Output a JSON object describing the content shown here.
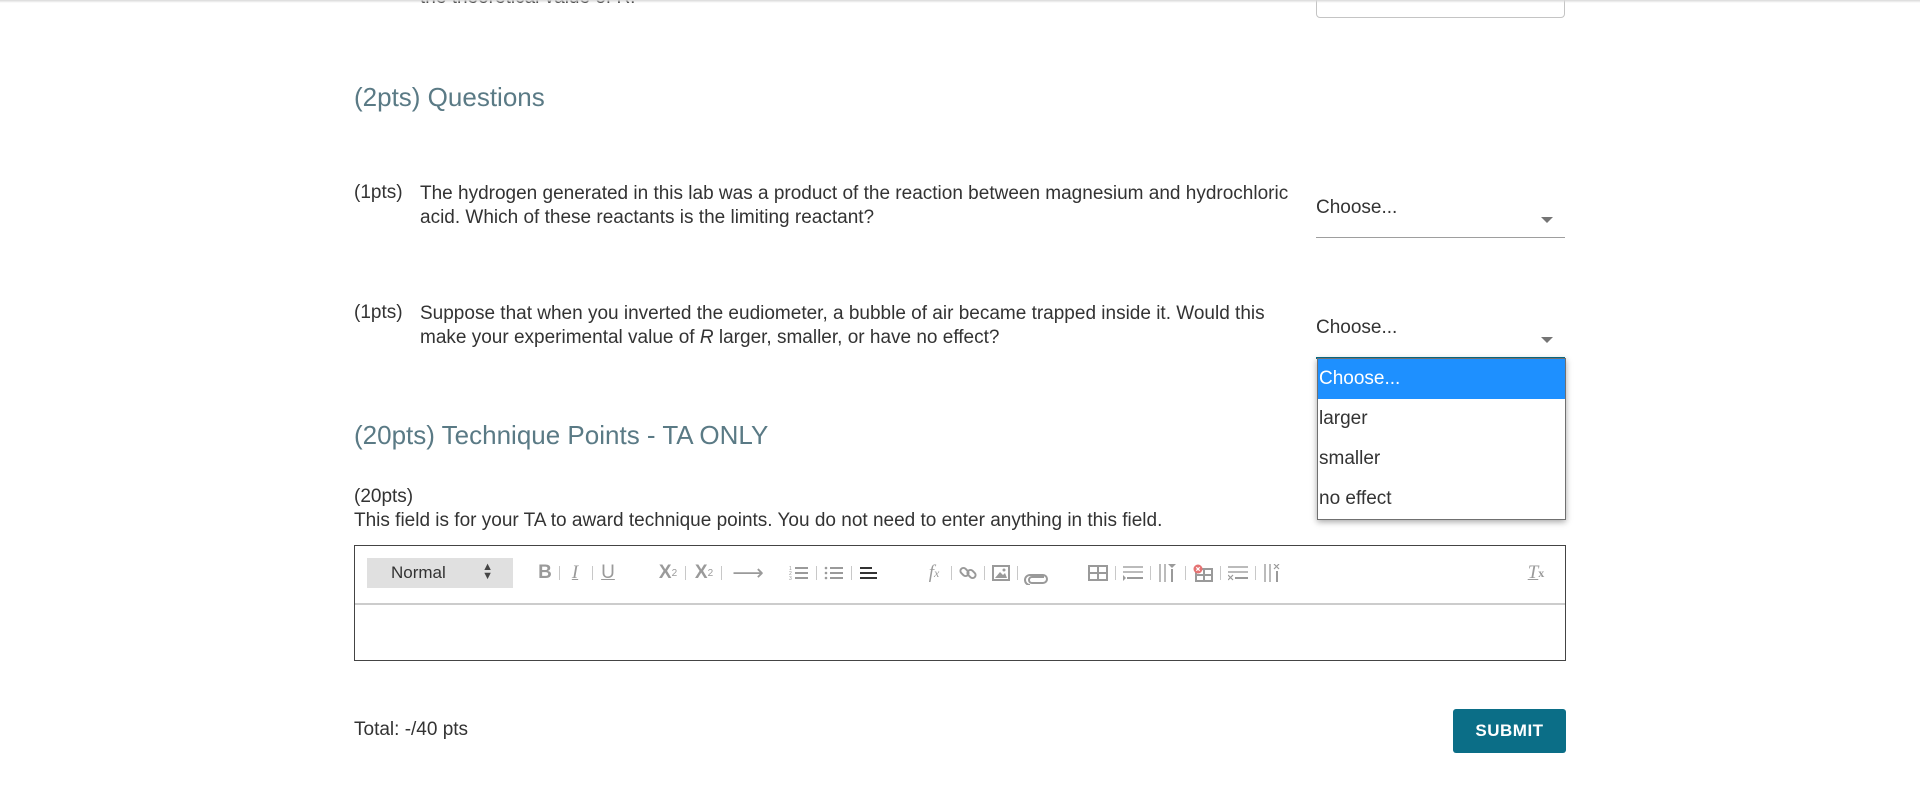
{
  "previous_question": {
    "cut_text": "the theoretical value of R."
  },
  "questions_section": {
    "title": "(2pts) Questions",
    "questions": [
      {
        "points": "(1pts)",
        "text": "The hydrogen generated in this lab was a product of the reaction between magnesium and hydrochloric acid. Which of these reactants is the limiting reactant?",
        "select_value": "Choose..."
      },
      {
        "points": "(1pts)",
        "text_before": "Suppose that when you inverted the eudiometer, a bubble of air became trapped inside it. Would this make your experimental value of ",
        "text_italic": "R",
        "text_after": " larger, smaller, or have no effect?",
        "select_value": "Choose...",
        "dropdown_open": true,
        "options": [
          "Choose...",
          "larger",
          "smaller",
          "no effect"
        ],
        "highlighted_option": "Choose..."
      }
    ]
  },
  "technique_section": {
    "title": "(20pts) Technique Points - TA ONLY",
    "points": "(20pts)",
    "description": "This field is for your TA to award technique points. You do not need to enter anything in this field.",
    "editor": {
      "format_select": "Normal",
      "toolbar_icons": [
        "bold",
        "italic",
        "underline",
        "subscript",
        "superscript",
        "arrow",
        "ordered-list",
        "bullet-list",
        "align",
        "formula",
        "link",
        "image",
        "attachment",
        "table",
        "insert-row",
        "insert-column",
        "delete-table",
        "delete-row",
        "delete-column",
        "clear-formatting"
      ],
      "content": ""
    }
  },
  "footer": {
    "total": "Total: -/40 pts",
    "submit_label": "SUBMIT"
  },
  "colors": {
    "section_title": "#5a7a85",
    "submit_bg": "#0b6e87",
    "dropdown_highlight": "#1e90ff"
  }
}
